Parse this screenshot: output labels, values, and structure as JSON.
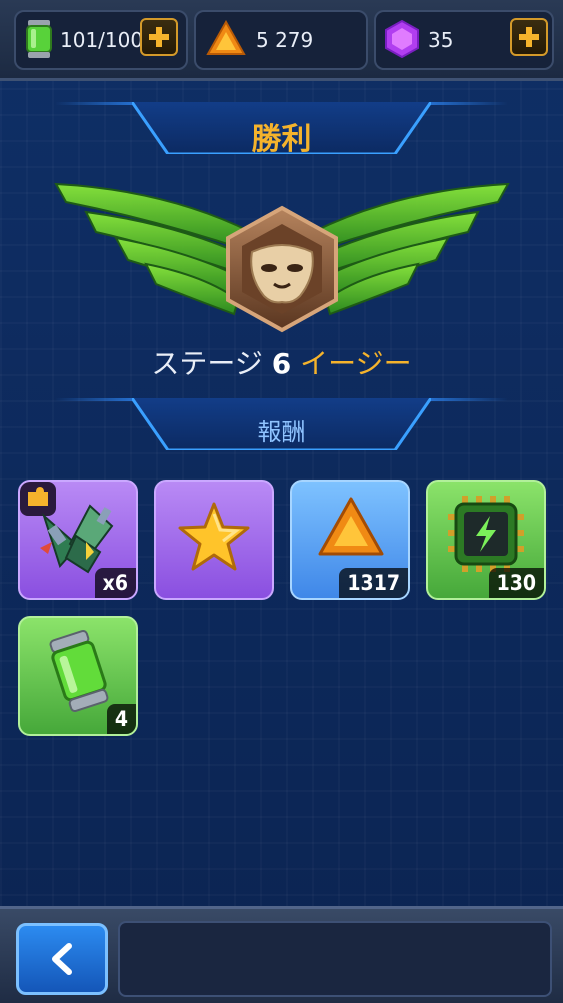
{
  "resources": {
    "energy": "101/100",
    "gold": "5 279",
    "gems": "35"
  },
  "result": {
    "title": "勝利",
    "stage_prefix": "ステージ",
    "stage_number": "6",
    "difficulty": "イージー"
  },
  "rewards": {
    "heading": "報酬",
    "items": [
      {
        "name": "ship-fragment",
        "qty": "x6"
      },
      {
        "name": "star",
        "qty": ""
      },
      {
        "name": "gold",
        "qty": "1317"
      },
      {
        "name": "energy-chip",
        "qty": "130"
      },
      {
        "name": "energy-canister",
        "qty": "4"
      }
    ]
  },
  "colors": {
    "title": "#f5b32c",
    "difficulty": "#f5b32c",
    "heading": "#8fc3ff"
  },
  "icons": [
    "energy-canister-icon",
    "plus-icon",
    "gold-crystal-icon",
    "gem-icon",
    "winged-rank-badge",
    "back-arrow-icon"
  ]
}
